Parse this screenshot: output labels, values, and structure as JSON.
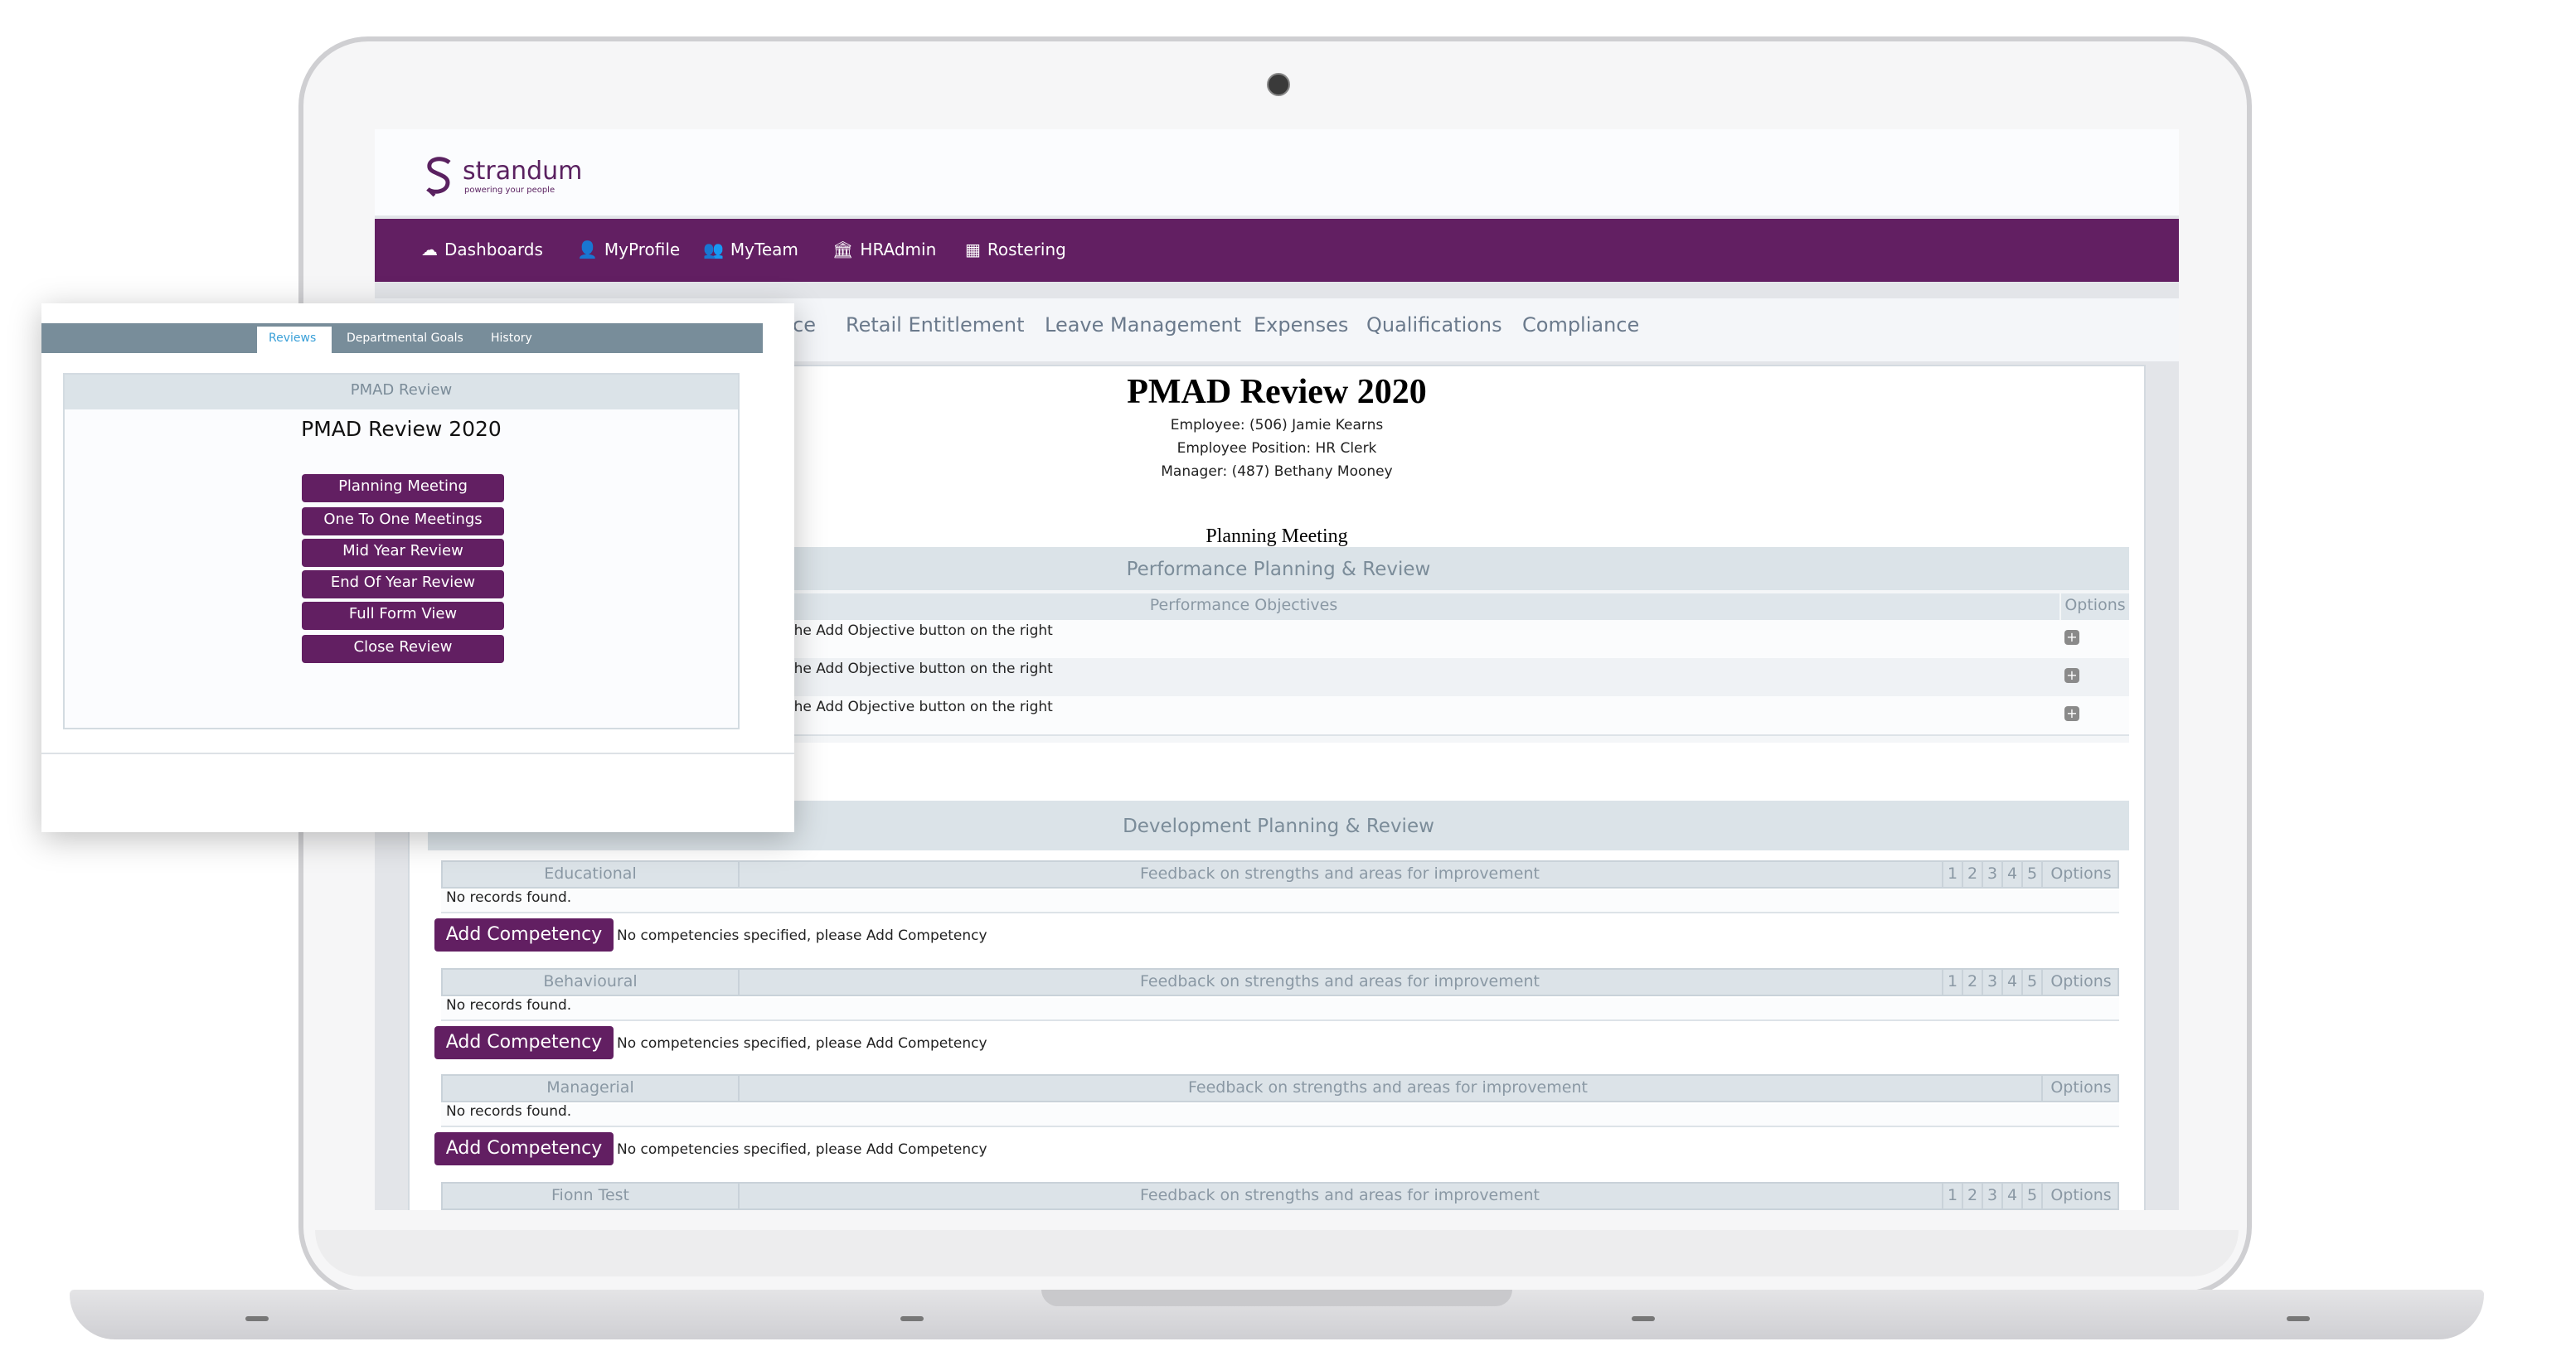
{
  "brand": {
    "name": "strandum",
    "tagline": "powering your people",
    "color": "#621f62"
  },
  "nav": [
    {
      "icon": "dashboard-icon",
      "label": "Dashboards"
    },
    {
      "icon": "user-icon",
      "label": "MyProfile"
    },
    {
      "icon": "team-icon",
      "label": "MyTeam"
    },
    {
      "icon": "bank-icon",
      "label": "HRAdmin"
    },
    {
      "icon": "calendar-icon",
      "label": "Rostering"
    }
  ],
  "module_tabs": [
    "ce",
    "Retail Entitlement",
    "Leave Management",
    "Expenses",
    "Qualifications",
    "Compliance"
  ],
  "review": {
    "title": "PMAD Review 2020",
    "employee": "Employee: (506) Jamie Kearns",
    "position": "Employee Position: HR Clerk",
    "manager": "Manager: (487) Bethany Mooney",
    "stage": "Planning Meeting"
  },
  "performance": {
    "header": "Performance Planning & Review",
    "col_objectives": "Performance Objectives",
    "col_options": "Options",
    "rows": [
      "l, click the Add Objective button on the right",
      "l, click the Add Objective button on the right",
      "l, click the Add Objective button on the right"
    ]
  },
  "development": {
    "header": "Development Planning & Review",
    "feedback_label": "Feedback on strengths and areas for improvement",
    "options_label": "Options",
    "no_records": "No records found.",
    "add_label": "Add Competency",
    "add_hint": "No competencies specified, please Add Competency",
    "scale": [
      "1",
      "2",
      "3",
      "4",
      "5"
    ],
    "categories": [
      {
        "name": "Educational",
        "show_scale": true
      },
      {
        "name": "Behavioural",
        "show_scale": true
      },
      {
        "name": "Managerial",
        "show_scale": false
      },
      {
        "name": "Fionn Test",
        "show_scale": true
      }
    ]
  },
  "overlay": {
    "tabs": [
      "Reviews",
      "Departmental Goals",
      "History"
    ],
    "active_tab": "Reviews",
    "box_header": "PMAD Review",
    "title": "PMAD Review 2020",
    "buttons": [
      "Planning Meeting",
      "One To One Meetings",
      "Mid Year Review",
      "End Of Year Review",
      "Full Form View",
      "Close Review"
    ],
    "active_tab_color": "#3aa0d8"
  }
}
